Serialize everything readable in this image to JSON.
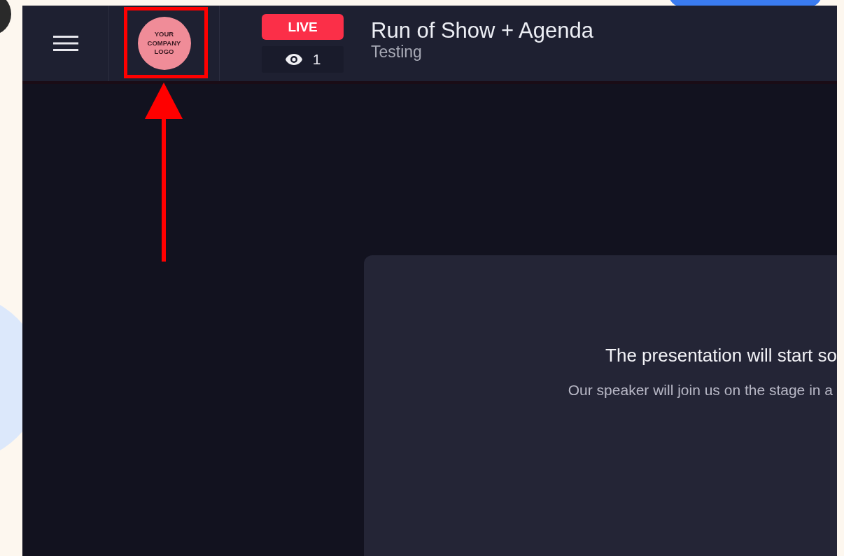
{
  "header": {
    "logo_lines": [
      "YOUR",
      "COMPANY",
      "LOGO"
    ],
    "live_badge": "LIVE",
    "viewer_count": "1",
    "title": "Run of Show + Agenda",
    "subtitle": "Testing"
  },
  "annotation": {
    "highlight_box": true,
    "arrow": true
  },
  "notice": {
    "title": "The presentation will start so",
    "message": "Our speaker will join us on the stage in a"
  }
}
